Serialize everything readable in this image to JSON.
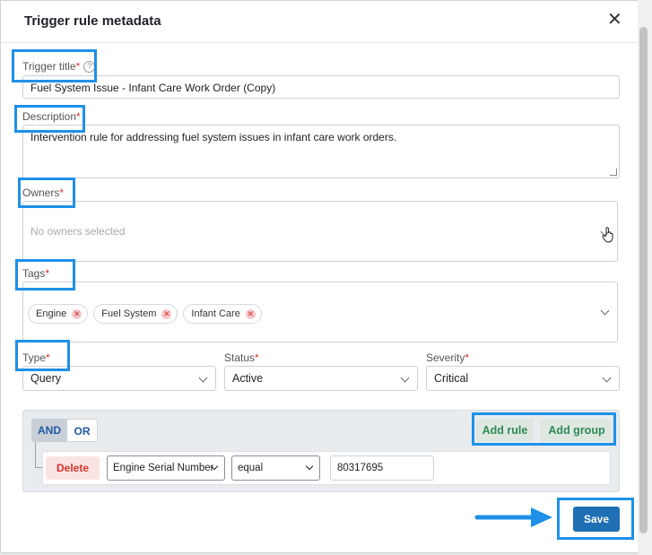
{
  "dialog": {
    "title": "Trigger rule metadata",
    "close_glyph": "✕"
  },
  "fields": {
    "trigger_title": {
      "label": "Trigger title",
      "value": "Fuel System Issue - Infant Care Work Order (Copy)"
    },
    "description": {
      "label": "Description",
      "value": "Intervention rule for addressing fuel system issues in infant care work orders."
    },
    "owners": {
      "label": "Owners",
      "placeholder": "No owners selected"
    },
    "tags": {
      "label": "Tags",
      "items": [
        "Engine",
        "Fuel System",
        "Infant Care"
      ]
    },
    "type": {
      "label": "Type",
      "value": "Query"
    },
    "status": {
      "label": "Status",
      "value": "Active"
    },
    "severity": {
      "label": "Severity",
      "value": "Critical"
    }
  },
  "required_mark": "*",
  "help_glyph": "?",
  "query_builder": {
    "and_label": "AND",
    "or_label": "OR",
    "add_rule_label": "Add rule",
    "add_group_label": "Add group",
    "rule": {
      "delete_label": "Delete",
      "field": "Engine Serial Number",
      "operator": "equal",
      "value": "80317695"
    }
  },
  "save_label": "Save",
  "colors": {
    "accent": "#1e90e8",
    "primary_button": "#1f6fb5",
    "green": "#2e8b57",
    "danger": "#d9342b"
  },
  "icons": {
    "close": "close-icon",
    "help": "help-icon",
    "chevron": "chevron-down-icon",
    "remove_tag": "remove-tag-icon",
    "cursor": "hand-cursor-icon",
    "arrow": "arrow-right-icon",
    "resize": "resize-handle-icon"
  }
}
